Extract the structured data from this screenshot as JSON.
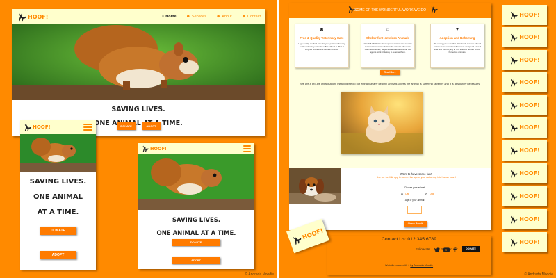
{
  "brand": {
    "logo_text": "HOOF!"
  },
  "nav": {
    "items": [
      {
        "label": "Home",
        "icon": "home-icon",
        "glyph": "⌂"
      },
      {
        "label": "Services",
        "icon": "paw-icon",
        "glyph": "☻"
      },
      {
        "label": "About",
        "icon": "paw-icon",
        "glyph": "☻"
      },
      {
        "label": "Contact",
        "icon": "paw-icon",
        "glyph": "☻"
      }
    ]
  },
  "hero": {
    "line1": "SAVING LIVES.",
    "line2": "ONE ANIMAL AT A TIME.",
    "mobile_line2": "ONE ANIMAL",
    "mobile_line3": "AT A TIME."
  },
  "buttons": {
    "donate": "DONATE",
    "adopt": "ADOPT"
  },
  "services": {
    "banner": "SOME OF THE WONDERFUL WORK WE DO",
    "cards": [
      {
        "icon": "camera-icon",
        "glyph": "◙",
        "title": "Free & Quality Veterinary Care",
        "text": "High quality medical care for your pets can be very costly and many animals suffer without it. That is why we provide this service for free."
      },
      {
        "icon": "home-icon",
        "glyph": "⌂",
        "title": "Shelter for Homeless Animals",
        "text": "Our 216 HOOF! centres spread accross the country serve as temporary shelters for animals who have been abandoned, neglected and abused while our agents work tirelessly to rehome them."
      },
      {
        "icon": "heart-icon",
        "glyph": "♥",
        "title": "Adoption and Rehoming",
        "text": "We strongly believe that all animals deserve should be loved and cared for. Therefore we spend a lot of time and effort trying to find suitable homes for our homeless animals."
      }
    ],
    "read_more": "Read More",
    "statement": "We are a pro-life organisation, meaning we do not euthanise any healthy animals unless the animal is suffering severely and it is absolutely necessary."
  },
  "quiz": {
    "title": "Want to have some fun?",
    "subtitle": "Use our fun little app to convert the age of your cat or dog into human years!",
    "choose_label": "Choose your animal:",
    "options": [
      "Cat",
      "Dog"
    ],
    "age_label": "Age of your animal:",
    "button": "Check Result"
  },
  "footer": {
    "contact": "Contact Us: 012 345 6789",
    "follow": "Follow Us:",
    "support": "Support Us:",
    "donate": "DONATE",
    "made_prefix": "Website made with",
    "made_by": "by Andrada Moodie"
  },
  "credits": {
    "left": "© Andrada Moodie",
    "right": "© Andrada Moodie"
  },
  "colors": {
    "accent": "#ff8a00",
    "cream": "#ffffcc",
    "button": "#ff7b00"
  }
}
